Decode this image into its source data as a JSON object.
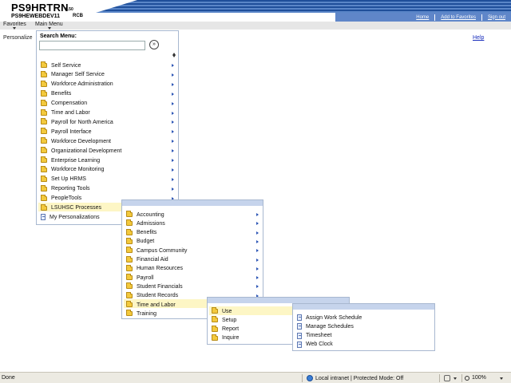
{
  "header": {
    "title": "PS9HRTRN",
    "version": "8.50",
    "database": "PS9HEWEBDEV11",
    "user": "RCB",
    "links": [
      "Home",
      "Add to Favorites",
      "Sign out"
    ]
  },
  "menubar": {
    "favorites": "Favorites",
    "main_menu": "Main Menu"
  },
  "personalize": "Personalize",
  "help": "Help",
  "search": {
    "label": "Search Menu:",
    "value": "",
    "go": "»"
  },
  "main_menu": [
    "Self Service",
    "Manager Self Service",
    "Workforce Administration",
    "Benefits",
    "Compensation",
    "Time and Labor",
    "Payroll for North America",
    "Payroll Interface",
    "Workforce Development",
    "Organizational Development",
    "Enterprise Learning",
    "Workforce Monitoring",
    "Set Up HRMS",
    "Reporting Tools",
    "PeopleTools",
    "LSUHSC Processes",
    "My Personalizations"
  ],
  "lsuhsc_menu": [
    "Accounting",
    "Admissions",
    "Benefits",
    "Budget",
    "Campus Community",
    "Financial Aid",
    "Human Resources",
    "Payroll",
    "Student Financials",
    "Student Records",
    "Time and Labor",
    "Training"
  ],
  "time_labor_menu": [
    "Use",
    "Setup",
    "Report",
    "Inquire"
  ],
  "use_menu": [
    "Assign Work Schedule",
    "Manage Schedules",
    "Timesheet",
    "Web Clock"
  ],
  "status": {
    "done": "Done",
    "zone": "Local intranet | Protected Mode: Off",
    "zoom": "100%"
  },
  "colors": {
    "nav_blue": "#5f86c9",
    "highlight": "#fdf6c5",
    "panel_head": "#c6d4ec"
  }
}
